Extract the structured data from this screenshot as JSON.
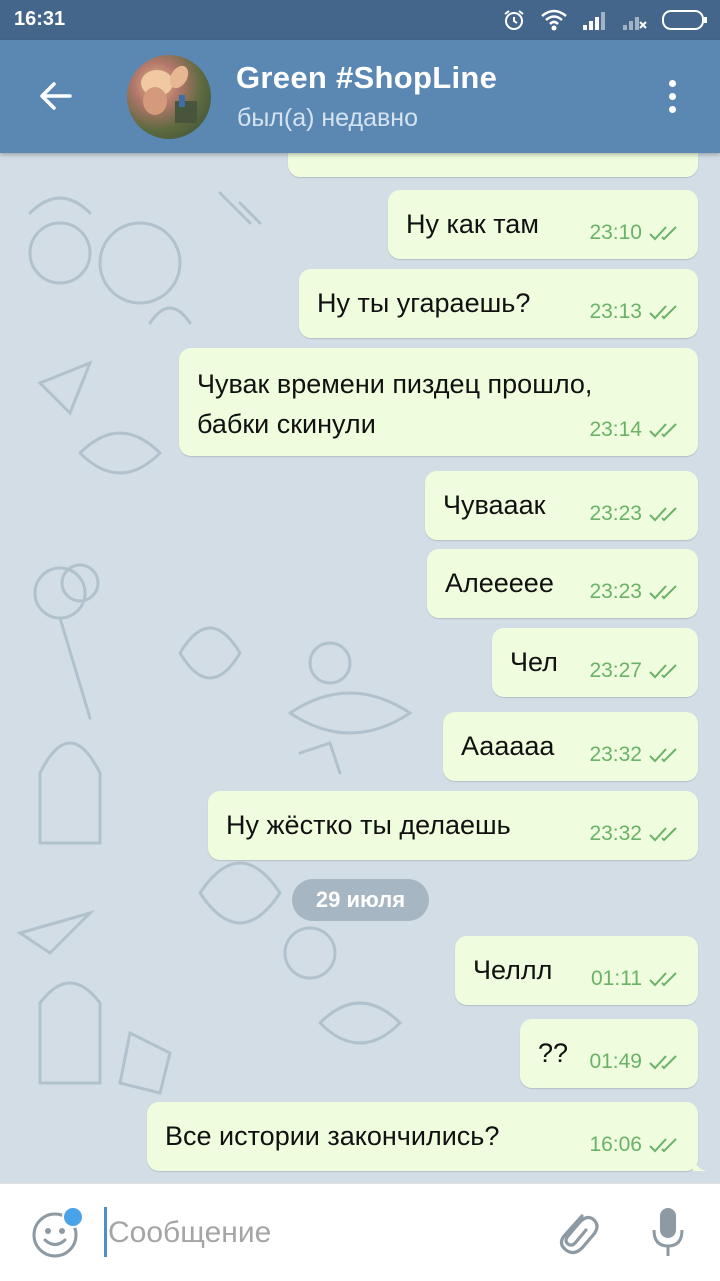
{
  "status_bar": {
    "time": "16:31",
    "icons": [
      "alarm-icon",
      "wifi-icon",
      "signal-icon",
      "signal-no-sim-icon",
      "battery-icon"
    ]
  },
  "header": {
    "back_icon": "arrow-left-icon",
    "title": "Green #ShopLine",
    "subtitle": "был(а) недавно",
    "menu_icon": "more-vertical-icon"
  },
  "messages": [
    {
      "text": "Ну как там",
      "time": "23:10"
    },
    {
      "text": "Ну ты угараешь?",
      "time": "23:13"
    },
    {
      "text": "Чувак времени пиздец прошло,\nбабки скинули",
      "time": "23:14"
    },
    {
      "text": "Чувааак",
      "time": "23:23"
    },
    {
      "text": "Алеееее",
      "time": "23:23"
    },
    {
      "text": "Чел",
      "time": "23:27"
    },
    {
      "text": "Аааааа",
      "time": "23:32"
    },
    {
      "text": "Ну жёстко ты делаешь",
      "time": "23:32"
    },
    {
      "text": "Челлл",
      "time": "01:11"
    },
    {
      "text": "??",
      "time": "01:49"
    },
    {
      "text": "Все истории закончились?",
      "time": "16:06"
    }
  ],
  "date_separator": "29 июля",
  "input": {
    "placeholder": "Сообщение",
    "value": ""
  },
  "colors": {
    "header": "#5b88b2",
    "status_bar": "#44668a",
    "bubble_out": "#effdde",
    "tick": "#6ab267",
    "chat_bg": "#d2dde6"
  }
}
